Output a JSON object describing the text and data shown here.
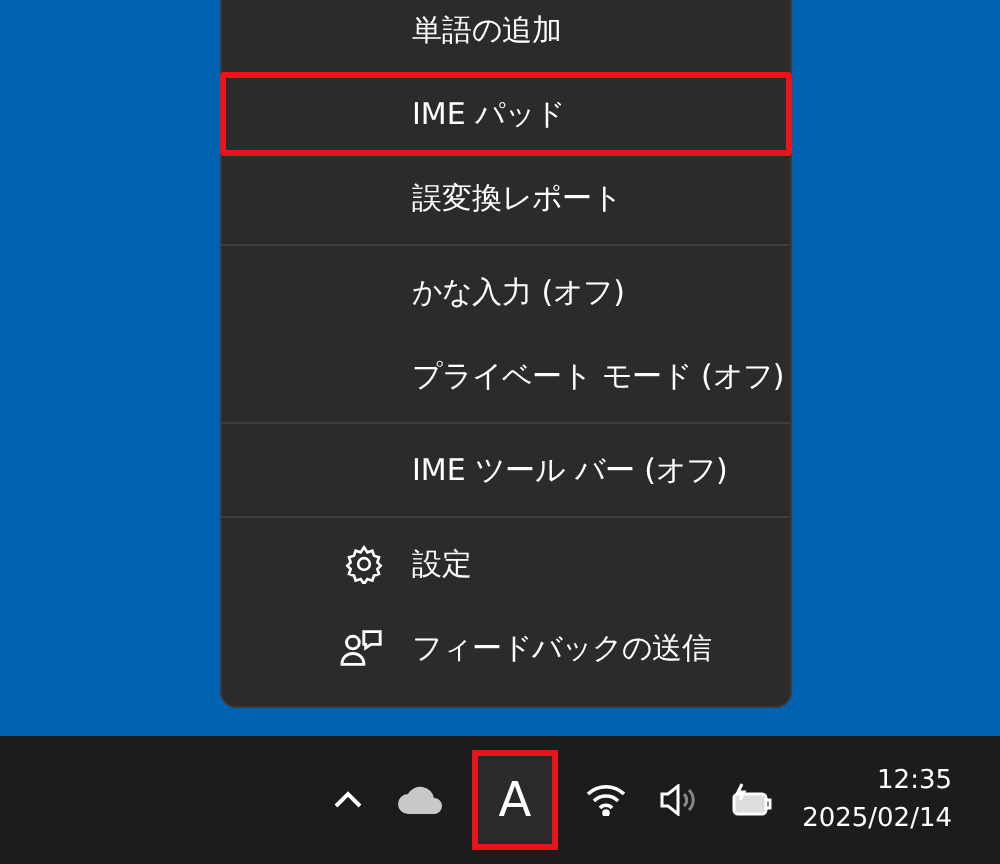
{
  "menu": {
    "sections": [
      {
        "items": [
          {
            "label": "単語の追加",
            "kind": "plain",
            "highlighted": false
          },
          {
            "label": "IME パッド",
            "kind": "plain",
            "highlighted": true
          },
          {
            "label": "誤変換レポート",
            "kind": "plain",
            "highlighted": false
          }
        ]
      },
      {
        "items": [
          {
            "label": "かな入力 (オフ)",
            "kind": "plain",
            "highlighted": false
          },
          {
            "label": "プライベート モード (オフ)",
            "kind": "plain",
            "highlighted": false
          }
        ]
      },
      {
        "items": [
          {
            "label": "IME ツール バー (オフ)",
            "kind": "plain",
            "highlighted": false
          }
        ]
      },
      {
        "items": [
          {
            "label": "設定",
            "kind": "settings",
            "highlighted": false
          },
          {
            "label": "フィードバックの送信",
            "kind": "feedback",
            "highlighted": false
          }
        ]
      }
    ]
  },
  "taskbar": {
    "ime_indicator": {
      "label": "A",
      "highlighted": true
    },
    "time": "12:35",
    "date": "2025/02/14"
  }
}
